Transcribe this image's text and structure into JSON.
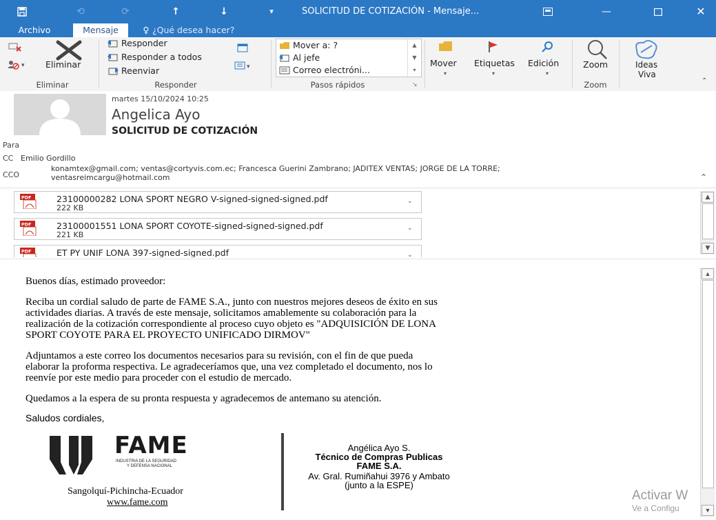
{
  "window": {
    "title": "SOLICITUD DE COTIZACIÓN - Mensaje...",
    "save_icon": "save-icon",
    "colors": {
      "titlebar": "#2b78c5",
      "ribbon": "#f3f3f3"
    }
  },
  "tabs": [
    {
      "label": "Archivo"
    },
    {
      "label": "Mensaje"
    },
    {
      "label": "¿Qué desea hacer?"
    }
  ],
  "ribbon": {
    "eliminar": {
      "delete_label": "Eliminar",
      "group": "Eliminar"
    },
    "responder": {
      "reply": "Responder",
      "reply_all": "Responder a todos",
      "forward": "Reenviar",
      "group": "Responder"
    },
    "quicksteps": {
      "move_to": "Mover a: ?",
      "to_boss": "Al jefe",
      "email": "Correo electróni...",
      "group": "Pasos rápidos"
    },
    "mover": "Mover",
    "etiquetas": "Etiquetas",
    "edicion": "Edición",
    "zoom": {
      "label": "Zoom",
      "group": "Zoom"
    },
    "ideas": {
      "line1": "Ideas",
      "line2": "Viva"
    }
  },
  "message": {
    "date": "martes 15/10/2024 10:25",
    "sender": "Angelica Ayo",
    "subject": "SOLICITUD DE COTIZACIÓN",
    "to_label": "Para",
    "cc_label": "CC",
    "cc_value": "Emilio Gordillo",
    "bcc_label": "CCO",
    "bcc_line1": "konamtex@gmail.com; ventas@cortyvis.com.ec; Francesca Guerini Zambrano; JADITEX VENTAS; JORGE DE LA TORRE;",
    "bcc_line2": "ventasreimcargu@hotmail.com"
  },
  "attachments": [
    {
      "name": "23100000282 LONA SPORT NEGRO V-signed-signed-signed.pdf",
      "size": "222 KB"
    },
    {
      "name": "23100001551 LONA SPORT COYOTE-signed-signed-signed.pdf",
      "size": "221 KB"
    },
    {
      "name": "ET PY UNIF LONA  397-signed-signed.pdf",
      "size": ""
    }
  ],
  "body": {
    "greeting": "Buenos días, estimado proveedor:",
    "p1_l1": "Reciba un cordial saludo de parte de FAME S.A., junto con nuestros mejores deseos de éxito en sus",
    "p1_l2": "actividades diarias. A través de este mensaje, solicitamos amablemente su colaboración para la",
    "p1_l3": "realización de la cotización correspondiente al proceso cuyo objeto es \"ADQUISICIÓN DE LONA",
    "p1_l4": "SPORT COYOTE PARA EL PROYECTO UNIFICADO DIRMOV\"",
    "p2_l1": "Adjuntamos a este correo los documentos necesarios para su revisión, con el fin de que pueda",
    "p2_l2": "elaborar la proforma respectiva. Le agradeceríamos que, una vez completado el documento, nos lo",
    "p2_l3": "reenvíe por este medio para proceder con el estudio de mercado.",
    "p3": "Quedamos a la espera de su pronta respuesta y agradecemos de antemano su atención.",
    "closing": "Saludos cordiales,"
  },
  "signature": {
    "logo_text": "FAME",
    "logo_sub1": "INDUSTRIA DE LA SEGURIDAD",
    "logo_sub2": "Y DEFENSA NACIONAL",
    "location": "Sangolquí-Pichincha-Ecuador",
    "website": "www.fame.com",
    "name": "Angélica Ayo S.",
    "role": "Técnico de Compras Publicas",
    "company": "FAME S.A.",
    "address": "Av. Gral. Rumiñahui 3976 y Ambato",
    "address2": "(junto a la ESPE)"
  },
  "watermark": {
    "line1": "Activar W",
    "line2": "Ve a Configu"
  }
}
